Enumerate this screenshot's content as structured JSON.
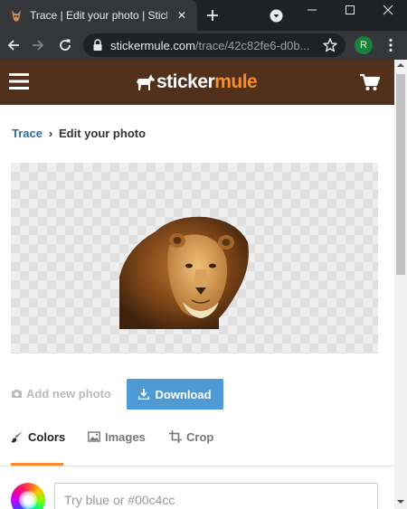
{
  "browser": {
    "tab_title": "Trace | Edit your photo | Sticker Mule",
    "tab_close": "✕",
    "url_host": "stickermule.com",
    "url_path": "/trace/42c82fe6-d0b...",
    "profile_initial": "R"
  },
  "site": {
    "logo_part1": "sticker",
    "logo_part2": "mule",
    "brand_color": "#51311c",
    "accent_color": "#f88c2c"
  },
  "breadcrumb": {
    "link": "Trace",
    "separator": "›",
    "current": "Edit your photo"
  },
  "actions": {
    "add_photo": "Add new photo",
    "download": "Download"
  },
  "tools": {
    "tabs": [
      {
        "label": "Colors",
        "icon": "brush-icon",
        "active": true
      },
      {
        "label": "Images",
        "icon": "image-icon",
        "active": false
      },
      {
        "label": "Crop",
        "icon": "crop-icon",
        "active": false
      }
    ]
  },
  "color_picker": {
    "placeholder": "Try blue or #00c4cc"
  }
}
